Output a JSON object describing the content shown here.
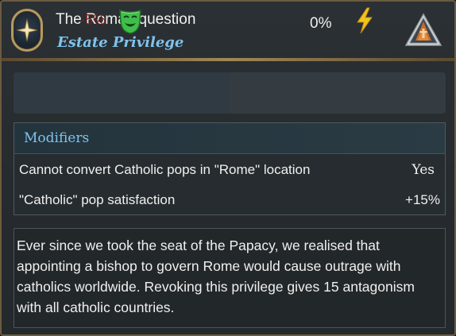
{
  "header": {
    "title": "The Roman question",
    "subtitle": "Estate Privilege",
    "emblem_icon": "compass-star-icon",
    "corner_icon": "clergy-estate-icon"
  },
  "effects": {
    "left": {
      "value": "-5%",
      "icon": "theater-mask-icon",
      "value_color": "#7a1e1e"
    },
    "right": {
      "value": "0%",
      "icon": "lightning-bolt-icon"
    }
  },
  "modifiers": {
    "title": "Modifiers",
    "rows": [
      {
        "label": "Cannot convert Catholic pops in \"Rome\" location",
        "value": "Yes"
      },
      {
        "label": "\"Catholic\" pop satisfaction",
        "value": "+15%"
      }
    ]
  },
  "description": {
    "text": " Ever since we took the seat of the Papacy, we realised that appointing a bishop to govern Rome would cause outrage with catholics worldwide. Revoking this privilege gives 15 antagonism with all catholic countries."
  },
  "colors": {
    "title": "#f0f0ee",
    "subtitle": "#7fc3ec",
    "border_gold": "#b59a63",
    "negative": "#7a1e1e"
  }
}
